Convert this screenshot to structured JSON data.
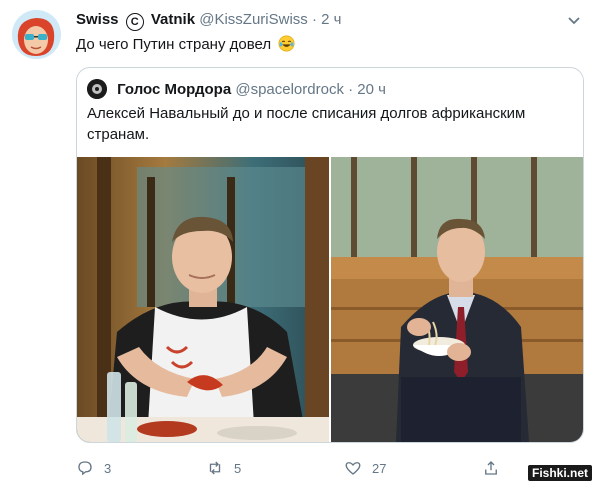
{
  "tweet": {
    "author_name": "Swiss",
    "author_middle": "Vatnik",
    "handle": "@KissZuriSwiss",
    "separator": "·",
    "time": "2 ч",
    "text": "До чего Путин страну довел",
    "emoji": "face-with-tears-of-joy"
  },
  "quoted_tweet": {
    "author_name": "Голос Мордора",
    "handle": "@spacelordrock",
    "separator": "·",
    "time": "20 ч",
    "text": "Алексей Навальный до и после списания долгов африканским странам."
  },
  "actions": {
    "reply_count": "3",
    "retweet_count": "5",
    "like_count": "27"
  },
  "watermark": "Fishki.net",
  "colors": {
    "muted": "#657786",
    "border": "#ccd6dd"
  }
}
